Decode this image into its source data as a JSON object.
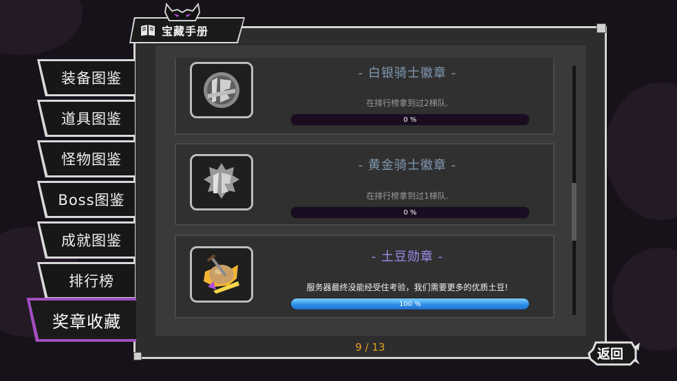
{
  "header": {
    "title": "宝藏手册",
    "icon": "book-icon",
    "decor_icon": "demon-head-icon"
  },
  "sidebar": {
    "items": [
      {
        "label": "装备图鉴",
        "active": false
      },
      {
        "label": "道具图鉴",
        "active": false
      },
      {
        "label": "怪物图鉴",
        "active": false
      },
      {
        "label": "Boss图鉴",
        "active": false
      },
      {
        "label": "成就图鉴",
        "active": false
      },
      {
        "label": "排行榜",
        "active": false
      },
      {
        "label": "奖章收藏",
        "active": true
      }
    ]
  },
  "medals": [
    {
      "name": "- 白银骑士徽章 -",
      "description": "在排行榜拿到过2梯队.",
      "progress_label": "0 %",
      "progress": 0,
      "icon": "silver-knight-badge-icon",
      "name_color": "#7f98b0",
      "desc_color": "#9a9a9a"
    },
    {
      "name": "- 黄金骑士徽章 -",
      "description": "在排行榜拿到过1梯队.",
      "progress_label": "0 %",
      "progress": 0,
      "icon": "gold-knight-badge-icon",
      "name_color": "#7f98b0",
      "desc_color": "#9a9a9a"
    },
    {
      "name": "- 土豆勋章 -",
      "description": "服务器最终没能经受住考验，我们需要更多的优质土豆!",
      "progress_label": "100 %",
      "progress": 1,
      "icon": "potato-medal-icon",
      "name_color": "#9a8ef0",
      "desc_color": "#f2f2f2"
    }
  ],
  "pagination": {
    "label": "9 / 13"
  },
  "back_button": {
    "label": "返回"
  },
  "colors": {
    "accent_purple": "#a24ec0",
    "page_number": "#e6a21f",
    "progress_blue": "#2f8fe8"
  }
}
